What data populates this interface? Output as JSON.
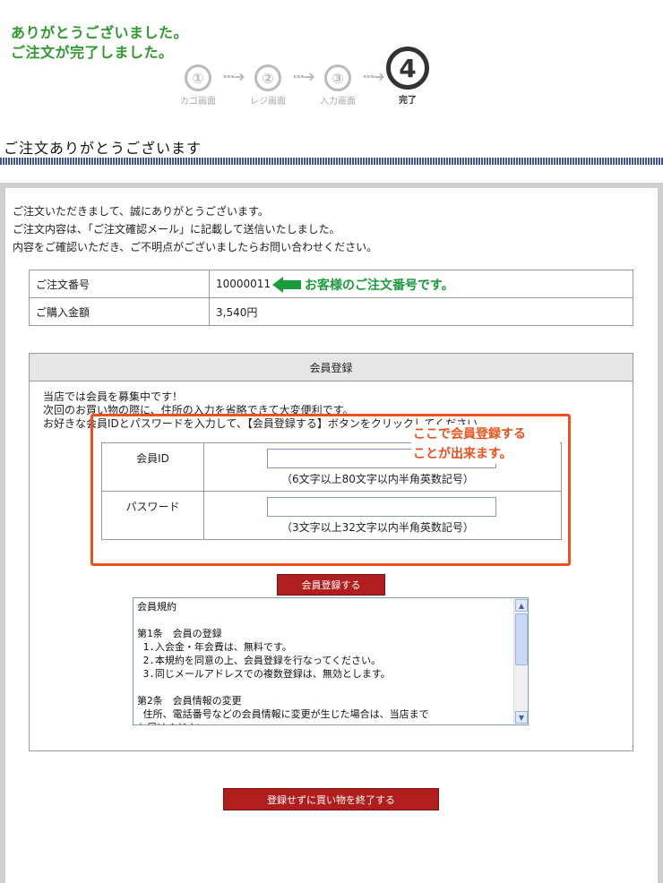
{
  "hero": {
    "line1": "ありがとうございました。",
    "line2": "ご注文が完了しました。"
  },
  "steps": [
    {
      "num": "①",
      "label": "カゴ画面"
    },
    {
      "num": "②",
      "label": "レジ画面"
    },
    {
      "num": "③",
      "label": "入力画面"
    },
    {
      "num": "④",
      "label": "完了"
    }
  ],
  "page_title": "ご注文ありがとうございます",
  "intro": {
    "line1": "ご注文いただきまして、誠にありがとうございます。",
    "line2": "ご注文内容は、「ご注文確認メール」に記載して送信いたしました。",
    "line3": "内容をご確認いただき、ご不明点がございましたらお問い合わせください。"
  },
  "order": {
    "number_label": "ご注文番号",
    "number_value": "10000011",
    "amount_label": "ご購入金額",
    "amount_value": "3,540円"
  },
  "callout_order": "お客様のご注文番号です。",
  "member": {
    "heading": "会員登録",
    "desc1": "当店では会員を募集中です！",
    "desc2": "次回のお買い物の際に、住所の入力を省略できて大変便利です。",
    "desc3": "お好きな会員IDとパスワードを入力して、【会員登録する】ボタンをクリックしてください。",
    "id_label": "会員ID",
    "id_note": "（6文字以上80文字以内半角英数記号）",
    "pw_label": "パスワード",
    "pw_note": "（3文字以上32文字以内半角英数記号）",
    "register_button": "会員登録する"
  },
  "callout_register": {
    "line1": "ここで会員登録する",
    "line2": "ことが出来ます。"
  },
  "terms_text": "会員規約\n\n第1条　会員の登録\n 1.入会金・年会費は、無料です。\n 2.本規約を同意の上、会員登録を行なってください。\n 3.同じメールアドレスでの複数登録は、無効とします。\n\n第2条　会員情報の変更\n 住所、電話番号などの会員情報に変更が生じた場合は、当店まで\nお届けください。",
  "finish_button": "登録せずに買い物を終了する",
  "colors": {
    "hero_green": "#2e9a2e",
    "callout_green": "#1b9c3c",
    "callout_orange": "#f0501c",
    "button_red": "#b01e1e"
  }
}
